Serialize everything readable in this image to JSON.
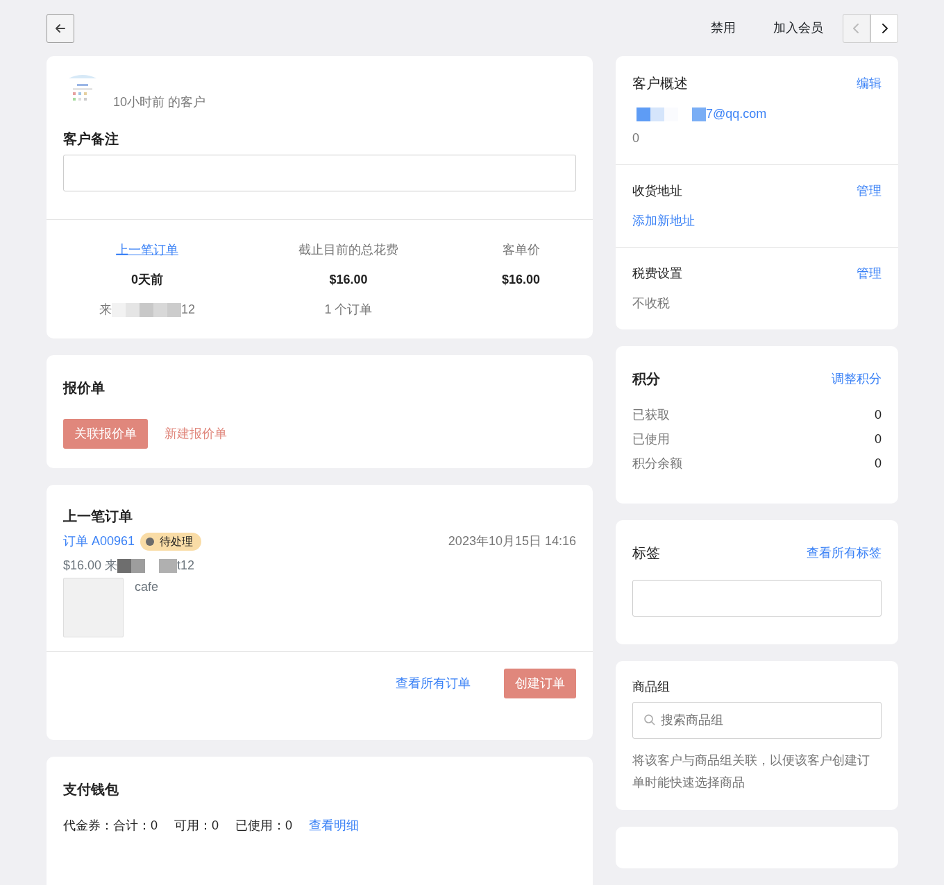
{
  "top_bar": {
    "actions": [
      "禁用",
      "加入会员"
    ],
    "pager": [
      {
        "disabled": true
      },
      {
        "disabled": false
      }
    ]
  },
  "customer_card": {
    "since": "10小时前 的客户",
    "note_label": "客户备注",
    "stats": [
      {
        "label": "上一笔订单",
        "link": true,
        "value": "0天前",
        "sub": "来",
        "sub_tail": "12"
      },
      {
        "label": "截止目前的总花费",
        "link": false,
        "value": "$16.00",
        "sub": "1 个订单"
      },
      {
        "label": "客单价",
        "link": false,
        "value": "$16.00"
      }
    ]
  },
  "quotes": {
    "title": "报价单",
    "buttons": [
      {
        "label": "关联报价单",
        "kind": "primary"
      },
      {
        "label": "新建报价单",
        "kind": "link"
      }
    ]
  },
  "last_order": {
    "title": "上一笔订单",
    "order_link": "订单 A00961",
    "status": {
      "label": "待处理",
      "color": "#f9dca6"
    },
    "date": "2023年10月15日 14:16",
    "price": "$16.00 来",
    "price_tail": "t12",
    "item_name": "cafe",
    "footer": [
      {
        "label": "查看所有订单",
        "kind": "link"
      },
      {
        "label": "创建订单",
        "kind": "primary"
      }
    ]
  },
  "wallet": {
    "title": "支付钱包",
    "items": [
      "代金券：合计：0",
      "可用：0",
      "已使用：0"
    ],
    "link": "查看明细"
  },
  "overview": {
    "title": "客户概述",
    "action": "编辑",
    "email_tail": "7@qq.com",
    "count": "0"
  },
  "address": {
    "title": "收货地址",
    "action": "管理",
    "link": "添加新地址"
  },
  "tax": {
    "title": "税费设置",
    "action": "管理",
    "value": "不收税"
  },
  "points": {
    "title": "积分",
    "action": "调整积分",
    "rows": [
      {
        "label": "已获取",
        "value": "0"
      },
      {
        "label": "已使用",
        "value": "0"
      },
      {
        "label": "积分余额",
        "value": "0"
      }
    ]
  },
  "tags": {
    "title": "标签",
    "action": "查看所有标签"
  },
  "product_groups": {
    "title": "商品组",
    "placeholder": "搜索商品组",
    "help": "将该客户与商品组关联，以便该客户创建订单时能快速选择商品"
  }
}
